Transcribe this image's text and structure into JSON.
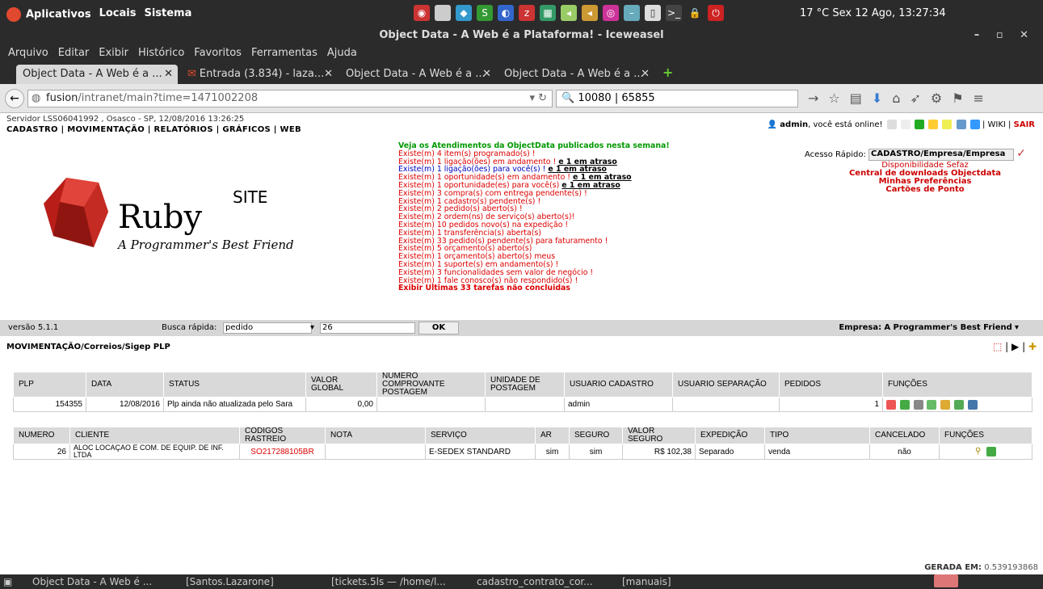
{
  "system": {
    "menu": [
      "Aplicativos",
      "Locais",
      "Sistema"
    ],
    "clock": "17 °C  Sex 12 Ago, 13:27:34"
  },
  "window": {
    "title": "Object Data - A Web é a Plataforma! - Iceweasel",
    "controls": "– ▫ ✕"
  },
  "browser_menu": [
    "Arquivo",
    "Editar",
    "Exibir",
    "Histórico",
    "Favoritos",
    "Ferramentas",
    "Ajuda"
  ],
  "tabs": [
    {
      "label": "Object Data - A Web é a ...",
      "close": "✕"
    },
    {
      "label": "Entrada (3.834) - laza...",
      "close": "✕"
    },
    {
      "label": "Object Data - A Web é a ...",
      "close": "✕"
    },
    {
      "label": "Object Data - A Web é a ...",
      "close": "✕"
    }
  ],
  "newtab": "+",
  "url": {
    "host": "fusion",
    "path": "/intranet/main?time=1471002208"
  },
  "search_value": "10080 | 65855",
  "header": {
    "server": "Servidor LSS06041992 , Osasco - SP, 12/08/2016 13:26:25",
    "menu": "CADASTRO | MOVIMENTAÇÃO | RELATÓRIOS | GRÁFICOS | WEB",
    "user": "admin",
    "online": ", você está online!",
    "links": "| WIKI |",
    "logout": "SAIR"
  },
  "banner": {
    "title": "Ruby",
    "subtitle": "A Programmer's Best Friend",
    "site": "SITE"
  },
  "notices": {
    "head": "Veja os Atendimentos da ObjectData publicados nesta semana!",
    "items": [
      {
        "text": "Existe(m) 4 item(s) programado(s) !",
        "cls": "red",
        "late": ""
      },
      {
        "text": "Existe(m) 1 ligação(ões) em andamento ! ",
        "cls": "red",
        "late": "e 1 em atraso"
      },
      {
        "text": "Existe(m) 1 ligação(ões) para você(s) ! ",
        "cls": "blue",
        "late": "e 1 em atraso"
      },
      {
        "text": "Existe(m) 1 oportunidade(s) em andamento ! ",
        "cls": "red",
        "late": "e 1 em atraso"
      },
      {
        "text": "Existe(m) 1 oportunidade(es) para você(s) ",
        "cls": "red",
        "late": "e 1 em atraso"
      },
      {
        "text": "Existe(m) 3 compra(s) com entrega pendente(s) !",
        "cls": "red",
        "late": ""
      },
      {
        "text": "Existe(m) 1 cadastro(s) pendente(s) !",
        "cls": "red",
        "late": ""
      },
      {
        "text": "Existe(m) 2 pedido(s) aberto(s) !",
        "cls": "red",
        "late": ""
      },
      {
        "text": "Existe(m) 2 ordem(ns) de serviço(s) aberto(s)!",
        "cls": "red",
        "late": ""
      },
      {
        "text": "Existe(m) 10 pedidos novo(s) na expedição !",
        "cls": "red",
        "late": ""
      },
      {
        "text": "Existe(m) 1 transferência(s) aberta(s)",
        "cls": "red",
        "late": ""
      },
      {
        "text": "Existe(m) 33 pedido(s) pendente(s) para faturamento !",
        "cls": "red",
        "late": ""
      },
      {
        "text": "Existe(m) 5 orçamento(s) aberto(s)",
        "cls": "red",
        "late": ""
      },
      {
        "text": "Existe(m) 1 orçamento(s) aberto(s) meus",
        "cls": "red",
        "late": ""
      },
      {
        "text": "Existe(m) 1 suporte(s) em andamento(s) !",
        "cls": "red",
        "late": ""
      },
      {
        "text": "Existe(m) 3 funcionalidades sem valor de negócio !",
        "cls": "red",
        "late": ""
      },
      {
        "text": "Existe(m) 1 fale conosco(s) não respondido(s) !",
        "cls": "red",
        "late": ""
      }
    ],
    "last": "Exibir Ultimas 33 tarefas não concluidas"
  },
  "quick": {
    "label": "Acesso Rápido:",
    "value": "CADASTRO/Empresa/Empresa",
    "links": [
      "Disponibilidade Sefaz",
      "Central de downloads Objectdata",
      "Minhas Preferências",
      "Cartões de Ponto"
    ]
  },
  "versionbar": {
    "version": "versão 5.1.1",
    "busca_label": "Busca rápida:",
    "busca_value": "pedido",
    "busca_num": "26",
    "ok": "OK",
    "empresa_label": "Empresa:",
    "empresa_value": "A Programmer's Best Friend"
  },
  "breadcrumb": "MOVIMENTAÇÃO/Correios/Sigep PLP",
  "plp_table": {
    "headers": [
      "PLP",
      "DATA",
      "STATUS",
      "VALOR GLOBAL",
      "NUMERO COMPROVANTE POSTAGEM",
      "UNIDADE DE POSTAGEM",
      "USUARIO CADASTRO",
      "USUARIO SEPARAÇÃO",
      "PEDIDOS",
      "FUNÇÕES"
    ],
    "row": [
      "154355",
      "12/08/2016",
      "Plp ainda não atualizada pelo Sara",
      "0,00",
      "",
      "",
      "admin",
      "",
      "1"
    ]
  },
  "items_table": {
    "headers": [
      "NUMERO",
      "CLIENTE",
      "CODIGOS RASTREIO",
      "NOTA",
      "SERVIÇO",
      "AR",
      "SEGURO",
      "VALOR SEGURO",
      "EXPEDIÇÃO",
      "TIPO",
      "CANCELADO",
      "FUNÇÕES"
    ],
    "row": [
      "26",
      "ALOC LOCAÇAO E COM. DE EQUIP. DE INF. LTDA",
      "SO217288105BR",
      "",
      "E-SEDEX STANDARD",
      "sim",
      "sim",
      "R$ 102,38",
      "Separado",
      "venda",
      "não"
    ]
  },
  "generated": {
    "label": "GERADA EM:",
    "value": "0.539193868"
  },
  "taskbar": [
    "Object Data - A Web é ...",
    "[Santos.Lazarone]",
    "[tickets.5ls — /home/l...",
    "cadastro_contrato_cor...",
    "[manuais]"
  ]
}
